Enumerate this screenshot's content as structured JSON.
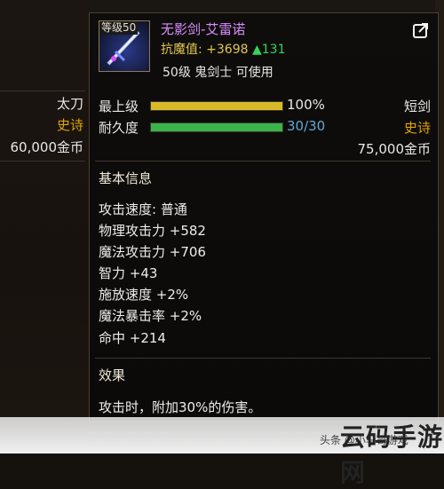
{
  "left_panel": {
    "type_value": "太刀",
    "rarity_value": "史诗",
    "price_value": "60,000金币"
  },
  "item": {
    "level_badge": "等级50",
    "name": "无影剑-艾雷诺",
    "resist_label": "抗魔值: +3698",
    "resist_gain": "▲131",
    "requirement": "50级 鬼剑士 可使用",
    "max_level_label": "最上级",
    "max_level_value": "100%",
    "max_level_progress": 1.0,
    "durability_label": "耐久度",
    "durability_value": "30/30",
    "durability_progress": 1.0,
    "weapon_type": "短剑",
    "rarity": "史诗",
    "price": "75,000金币",
    "basic_info_title": "基本信息",
    "stats": [
      "攻击速度: 普通",
      "物理攻击力 +582",
      "魔法攻击力 +706",
      "智力 +43",
      "施放速度 +2%",
      "魔法暴击率 +2%",
      "命中 +214"
    ],
    "effect_title": "效果",
    "effect_text": "攻击时，附加30%的伤害。"
  },
  "colors": {
    "epic": "#e1a400",
    "name": "#d98cff",
    "resist": "#e1c84e",
    "gain": "#36d35b",
    "max_level_bar": "#d9b92a",
    "durability_bar": "#39b44a",
    "durability_text": "#5fa8d6"
  },
  "watermark": {
    "small_text": "头条 @小马哥游戏",
    "brand": "云码手游网"
  }
}
